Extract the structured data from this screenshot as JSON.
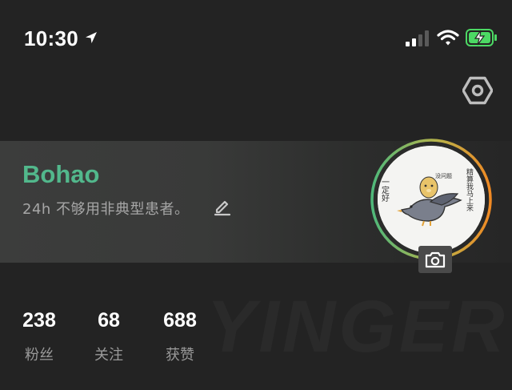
{
  "status_bar": {
    "time": "10:30",
    "icons": [
      "location-arrow-icon",
      "signal-icon",
      "wifi-icon",
      "battery-charging-icon"
    ]
  },
  "settings": {
    "icon": "hexagon-gear-icon"
  },
  "profile": {
    "username": "Bohao",
    "bio": "24h 不够用非典型患者。",
    "edit_icon": "pencil-icon",
    "avatar_icon": "pigeon-sticker-avatar",
    "avatar_text": {
      "left": "一定好",
      "right": "精算我马上来",
      "bubble": "没问题"
    },
    "camera_icon": "camera-icon"
  },
  "stats": {
    "followers": {
      "value": "238",
      "label": "粉丝"
    },
    "following": {
      "value": "68",
      "label": "关注"
    },
    "likes": {
      "value": "688",
      "label": "获赞"
    }
  },
  "watermark": "YINGER",
  "colors": {
    "background": "#232323",
    "username": "#52b88c",
    "ring_start": "#4fb87a",
    "ring_end": "#f08a24",
    "battery": "#4cd964"
  }
}
